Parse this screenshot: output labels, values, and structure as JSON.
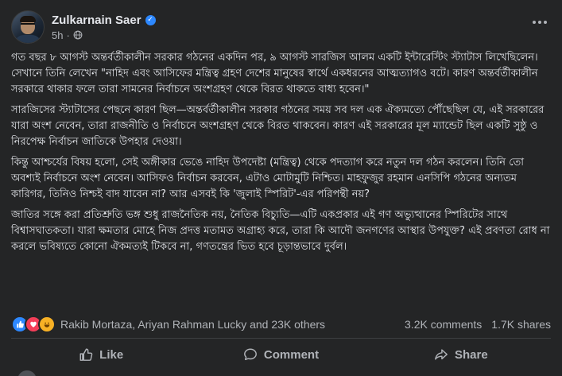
{
  "author": {
    "name": "Zulkarnain Saer",
    "time": "5h",
    "separator": "·"
  },
  "icons": {
    "verified": "verified-badge-icon",
    "privacy": "globe-icon",
    "more": "more-options-icon",
    "like": "thumbs-up-icon",
    "comment": "comment-bubble-icon",
    "share": "share-arrow-icon"
  },
  "post": {
    "paragraphs": [
      "গত বছর ৮ আগস্ট অন্তর্বর্তীকালীন সরকার গঠনের একদিন পর, ৯ আগস্ট সারজিস আলম একটি ইন্টারেস্টিং স্ট্যাটাস লিখেছিলেন। সেখানে তিনি লেখেন \"নাহিদ এবং আসিফের মন্ত্রিত্ব গ্রহণ দেশের মানুষের স্বার্থে একধরনের আত্মত্যাগও বটে। কারণ অন্তর্বর্তীকালীন সরকারে থাকার ফলে তারা সামনের নির্বাচনে অংশগ্রহণ থেকে বিরত থাকতে বাধ্য হবেন।\"",
      "সারজিসের স্ট্যাটাসের পেছনে কারণ ছিল—অন্তর্বর্তীকালীন সরকার গঠনের সময় সব দল এক ঐক্যমত্যে পৌঁছেছিল যে, এই সরকারের যারা অংশ নেবেন, তারা রাজনীতি ও নির্বাচনে অংশগ্রহণ থেকে বিরত থাকবেন। কারণ এই সরকারের মূল ম্যান্ডেট ছিল একটি সুষ্ঠু ও নিরপেক্ষ নির্বাচন জাতিকে উপহার দেওয়া।",
      "কিন্তু আশ্চর্যের বিষয় হলো, সেই অঙ্গীকার ভেঙে নাহিদ উপদেষ্টা (মন্ত্রিত্ব) থেকে পদত্যাগ করে নতুন দল গঠন করলেন। তিনি তো অবশ্যই নির্বাচনে অংশ নেবেন। আসিফও নির্বাচন করবেন, এটাও মোটামুটি নিশ্চিত। মাহফুজুর রহমান এনসিপি গঠনের অন্যতম কারিগর, তিনিও নিশ্চই বাদ যাবেন না? আর এসবই কি 'জুলাই স্পিরিট'-এর পরিপন্থী নয়?",
      "জাতির সঙ্গে করা প্রতিশ্রুতি ভঙ্গ শুধু রাজনৈতিক নয়, নৈতিক বিচ্যুতি—এটি একপ্রকার এই গণ অভ্যুত্থানের স্পিরিটের সাথে বিশ্বাসঘাতকতা। যারা ক্ষমতার মোহে নিজ প্রদত্ত মতামত অগ্রাহ্য করে, তারা কি আদৌ জনগণের আস্থার উপযুক্ত? এই প্রবণতা রোধ না করলে ভবিষ্যতে কোনো ঐকমত্যই টিকবে না, গণতন্ত্রের ভিত হবে চূড়ান্তভাবে দুর্বল।"
    ]
  },
  "engagement": {
    "reactions": [
      "like",
      "love",
      "haha"
    ],
    "reactors_text": "Rakib Mortaza, Ariyan Rahman Lucky and 23K others",
    "comments": "3.2K comments",
    "shares": "1.7K shares"
  },
  "actions": {
    "like": "Like",
    "comment": "Comment",
    "share": "Share"
  },
  "colors": {
    "background": "#242526",
    "text_primary": "#e4e6eb",
    "text_secondary": "#b0b3b8",
    "verified": "#2d88ff",
    "divider": "#3e4042"
  }
}
